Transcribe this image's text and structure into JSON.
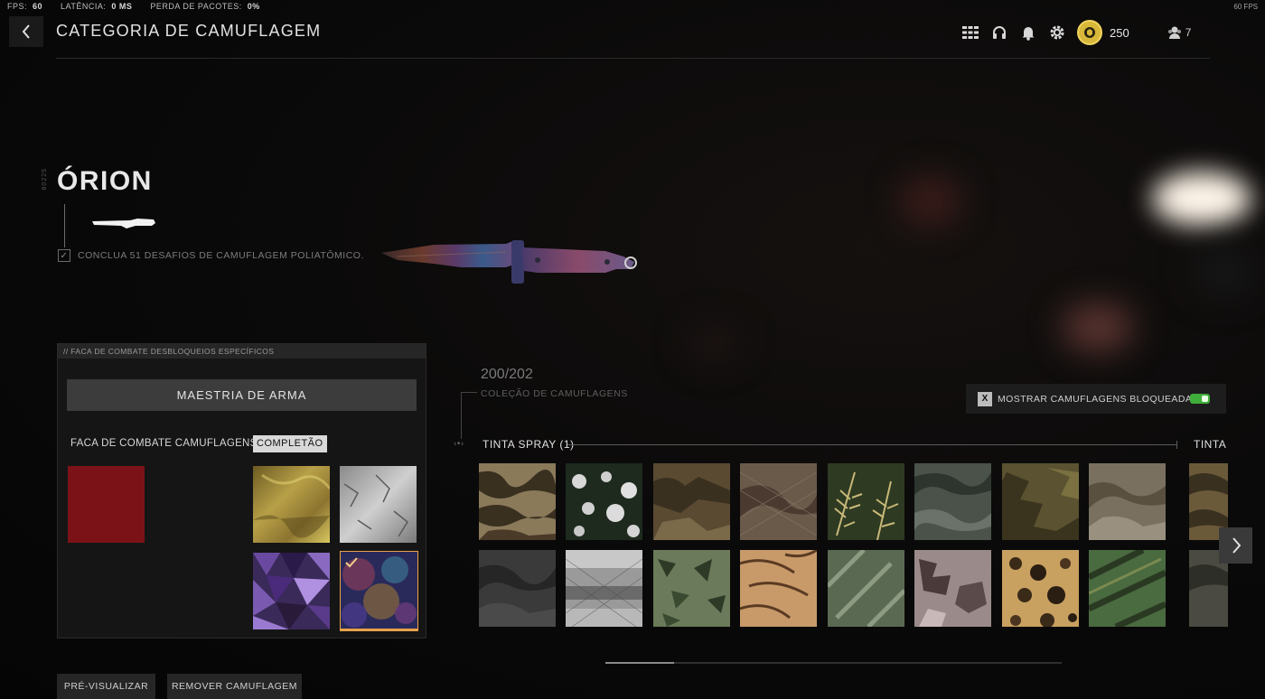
{
  "debug": {
    "fps_label": "FPS:",
    "fps_value": "60",
    "latency_label": "LATÊNCIA:",
    "latency_value": "0 MS",
    "packet_label": "PERDA DE PACOTES:",
    "packet_value": "0%",
    "fps_right": "60 FPS"
  },
  "header": {
    "title": "CATEGORIA DE CAMUFLAGEM",
    "coin_value": "250",
    "party_count": "7"
  },
  "camo": {
    "id_text": "80225",
    "name": "ÓRION",
    "challenge": "CONCLUA 51 DESAFIOS DE CAMUFLAGEM POLIATÔMICO."
  },
  "panel": {
    "header": "// FACA DE COMBATE DESBLOQUEIOS ESPECÍFICOS",
    "mastery_button": "MAESTRIA DE ARMA",
    "category_label": "FACA DE COMBATE CAMUFLAGENS",
    "completion_badge": "COMPLETÃO",
    "selected_color": "#7b1218",
    "mastery_camos": [
      "gold",
      "platinum",
      "polyatomic",
      "orion"
    ]
  },
  "collection": {
    "count": "200/202",
    "label": "COLEÇÃO DE CAMUFLAGENS",
    "toggle_key": "X",
    "toggle_label": "MOSTRAR CAMUFLAGENS BLOQUEADAS",
    "toggle_on": true,
    "section": "TINTA SPRAY (1)",
    "next_section": "TINTA",
    "scroll_fraction": 0.15
  },
  "buttons": {
    "preview": "PRÉ-VISUALIZAR",
    "remove": "REMOVER CAMUFLAGEM"
  },
  "colors": {
    "accent_orange": "#e8a24a",
    "toggle_green": "#3fae3a"
  }
}
